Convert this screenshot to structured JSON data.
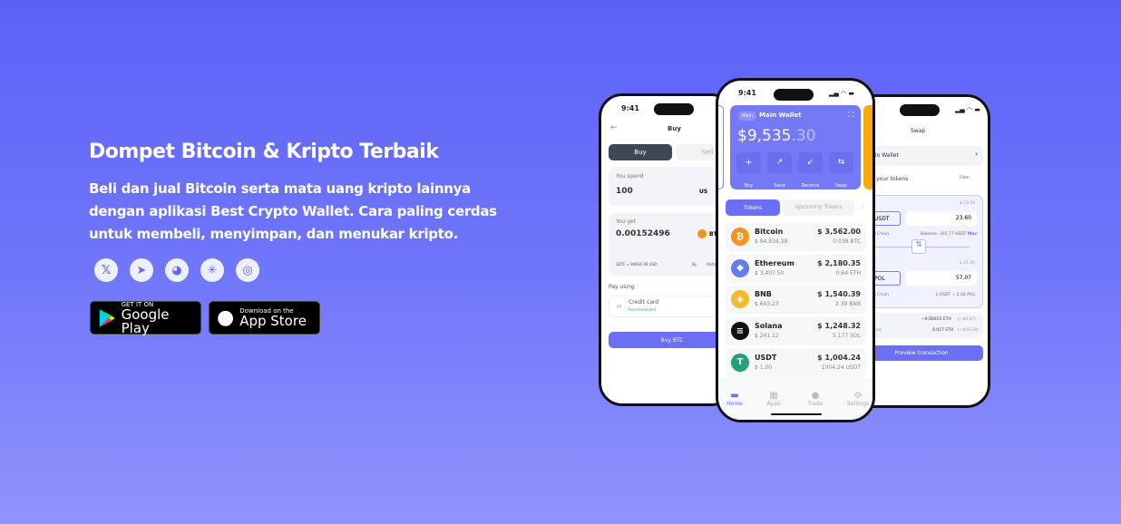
{
  "hero": {
    "title": "Dompet Bitcoin & Kripto Terbaik",
    "description": "Beli dan jual Bitcoin serta mata uang kripto lainnya dengan aplikasi Best Crypto Wallet. Cara paling cerdas untuk membeli, menyimpan, dan menukar kripto."
  },
  "socials": [
    {
      "icon": "x-icon",
      "glyph": "𝕏"
    },
    {
      "icon": "telegram-icon",
      "glyph": "➤"
    },
    {
      "icon": "discord-icon",
      "glyph": "◕"
    },
    {
      "icon": "linktree-icon",
      "glyph": "✳"
    },
    {
      "icon": "instagram-icon",
      "glyph": "◎"
    }
  ],
  "stores": {
    "google": {
      "small": "GET IT ON",
      "big": "Google Play"
    },
    "apple": {
      "small": "Download on the",
      "big": "App Store"
    }
  },
  "buy_screen": {
    "time": "9:41",
    "title": "Buy",
    "tab_buy": "Buy",
    "tab_sell": "Sell",
    "spend_label": "You spend",
    "spend_value": "100",
    "spend_currency": "US",
    "get_label": "You get",
    "get_value": "0.00152496",
    "get_currency": "BT",
    "rate": "1BTC ≈ 94834.38 USD",
    "provider": "By",
    "provider_name": "Alchemy",
    "pay_using": "Pay using",
    "method": "Credit card",
    "method_badge": "Recommended",
    "cta": "Buy BTC"
  },
  "wallet_screen": {
    "time": "9:41",
    "badge": "Main",
    "wallet_name": "Main Wallet",
    "balance_main": "$9,535",
    "balance_cents": ".30",
    "actions": [
      "Buy",
      "Send",
      "Receive",
      "Swap"
    ],
    "tabs": [
      "Tokens",
      "Upcoming Tokens"
    ],
    "tokens": [
      {
        "name": "Bitcoin",
        "price": "$ 94,834.38",
        "value": "$ 3,562.00",
        "amount": "0.038 BTC",
        "color": "#f7931a",
        "glyph": "₿"
      },
      {
        "name": "Ethereum",
        "price": "$ 3,407.50",
        "value": "$ 2,180.35",
        "amount": "0.64 ETH",
        "color": "#627eea",
        "glyph": "◆"
      },
      {
        "name": "BNB",
        "price": "$ 643.23",
        "value": "$ 1,540.39",
        "amount": "2.39 BNB",
        "color": "#f3ba2f",
        "glyph": "◈"
      },
      {
        "name": "Solana",
        "price": "$ 241.12",
        "value": "$ 1,248.32",
        "amount": "5.177 SOL",
        "color": "#111111",
        "glyph": "≡"
      },
      {
        "name": "USDT",
        "price": "$ 1.00",
        "value": "$ 1,004.24",
        "amount": "1004.24 USDT",
        "color": "#26a17b",
        "glyph": "T"
      }
    ],
    "nav": [
      "Home",
      "Apps",
      "Trade",
      "Settings"
    ]
  },
  "swap_screen": {
    "title": "Swap",
    "wallet": "Main Wallet",
    "tokens_label": "Swap your tokens",
    "filter": "Filter",
    "from_usd": "$ 23.50",
    "from_token": "USDT",
    "from_amount": "23.60",
    "from_chain": "Main Chain",
    "balance": "Balance: 101.77 USDT",
    "max": "Max",
    "to_usd": "$ 21.50",
    "to_token": "POL",
    "to_amount": "57.07",
    "to_chain": "Main Chain",
    "rate": "1 USDT = 2.42 POL",
    "fee_label": "Fee",
    "fee_value": "~0.00015 ETH",
    "fee_usd": "(~$0.47)",
    "balance_label": "Balance",
    "balance_value": "0.017 ETH",
    "balance_usd": "(~$52.29)",
    "cta": "Preview transaction"
  }
}
